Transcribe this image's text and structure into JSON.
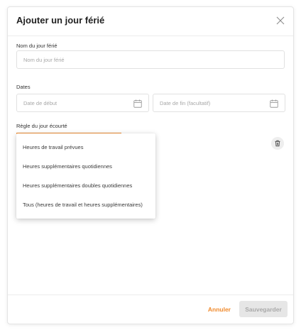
{
  "modal": {
    "title": "Ajouter un jour férié"
  },
  "name_field": {
    "label": "Nom du jour férié",
    "placeholder": "Nom du jour férié",
    "value": ""
  },
  "dates": {
    "label": "Dates",
    "start_placeholder": "Date de début",
    "end_placeholder": "Date de fin (facultatif)"
  },
  "rule": {
    "label": "Règle du jour écourté",
    "options": [
      "Heures de travail prévues",
      "Heures supplémentaires quotidiennes",
      "Heures supplémentaires doubles quotidiennes",
      "Tous (heures de travail et heures supplémentaires)"
    ]
  },
  "footer": {
    "cancel_label": "Annuler",
    "save_label": "Sauvegarder"
  },
  "icons": {
    "close": "close-icon",
    "calendar": "calendar-icon",
    "trash": "trash-icon"
  },
  "colors": {
    "accent": "#f08a2c",
    "disabled_bg": "#e6e6e6",
    "disabled_text": "#a9a9a9"
  }
}
